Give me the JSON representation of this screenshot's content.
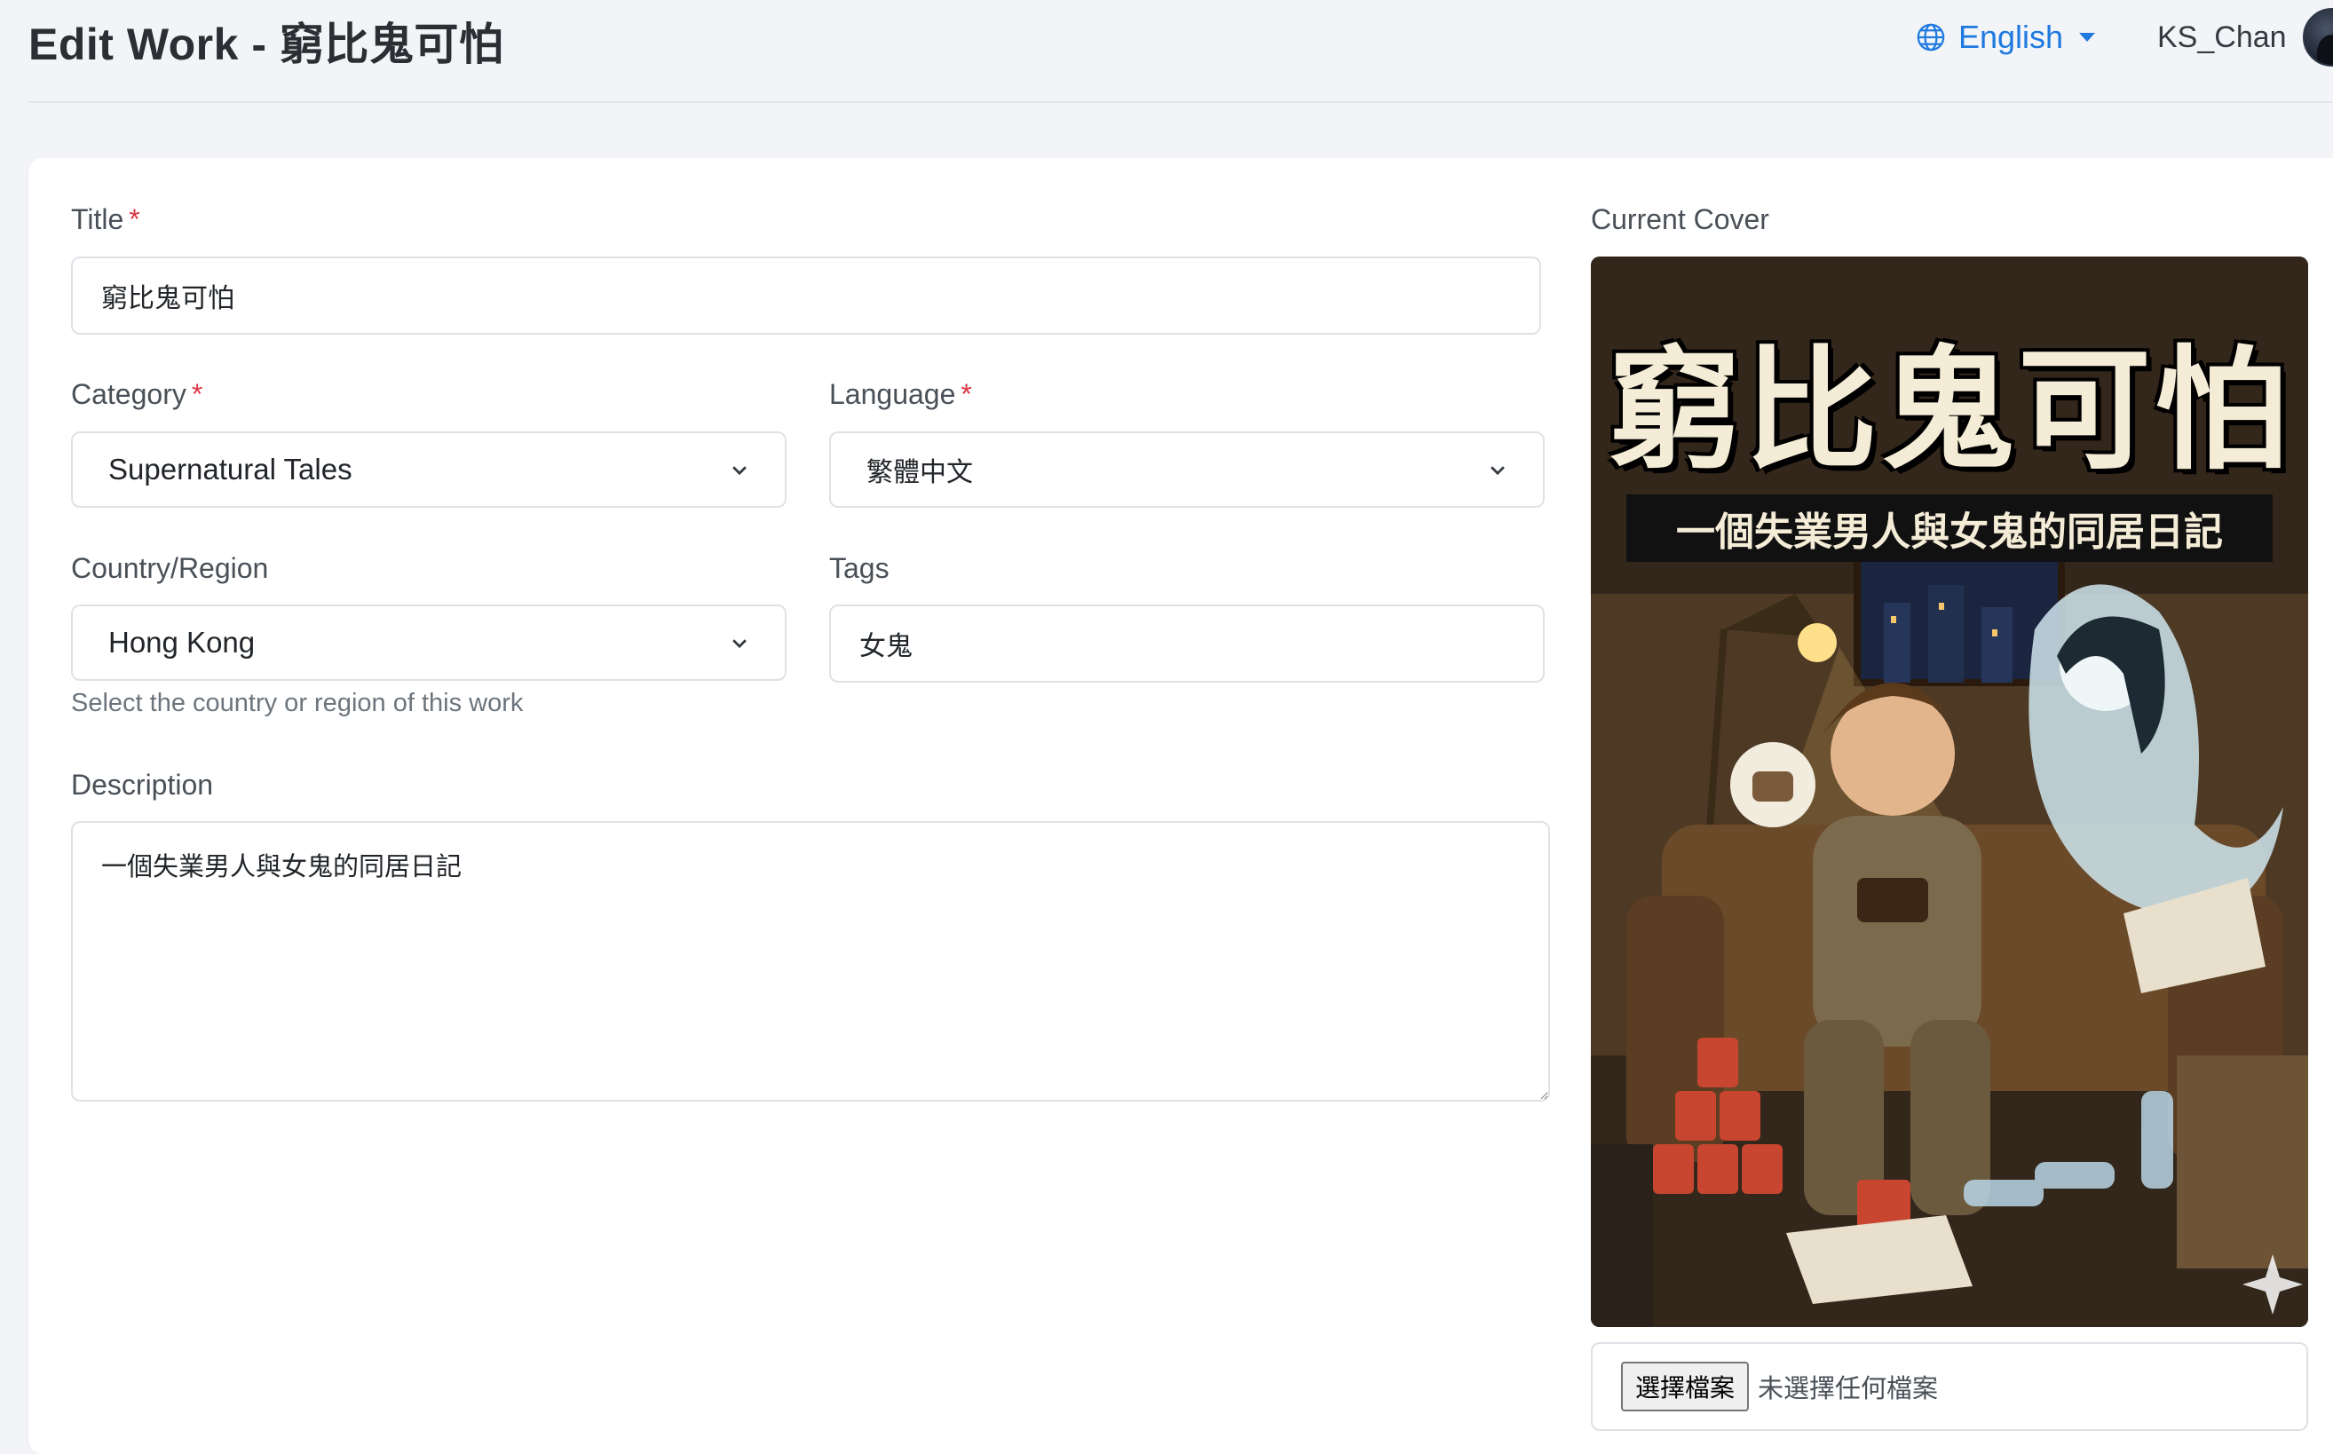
{
  "header": {
    "title": "Edit Work - 窮比鬼可怕",
    "language_switcher": {
      "label": "English",
      "icon": "globe-icon"
    },
    "user": {
      "name": "KS_Chan",
      "avatar": "avatar"
    }
  },
  "form": {
    "title": {
      "label": "Title",
      "required_mark": "*",
      "value": "窮比鬼可怕"
    },
    "category": {
      "label": "Category",
      "required_mark": "*",
      "selected": "Supernatural Tales"
    },
    "language": {
      "label": "Language",
      "required_mark": "*",
      "selected": "繁體中文"
    },
    "country": {
      "label": "Country/Region",
      "selected": "Hong Kong",
      "help": "Select the country or region of this work"
    },
    "tags": {
      "label": "Tags",
      "value": "女鬼"
    },
    "description": {
      "label": "Description",
      "value": "一個失業男人與女鬼的同居日記"
    }
  },
  "cover": {
    "label": "Current Cover",
    "image_title": "窮比鬼可怕",
    "image_subtitle": "一個失業男人與女鬼的同居日記",
    "file_button": "選擇檔案",
    "file_status": "未選擇任何檔案"
  },
  "colors": {
    "accent": "#1f7ae0",
    "required": "#dc3545",
    "background": "#f3f4f7"
  }
}
